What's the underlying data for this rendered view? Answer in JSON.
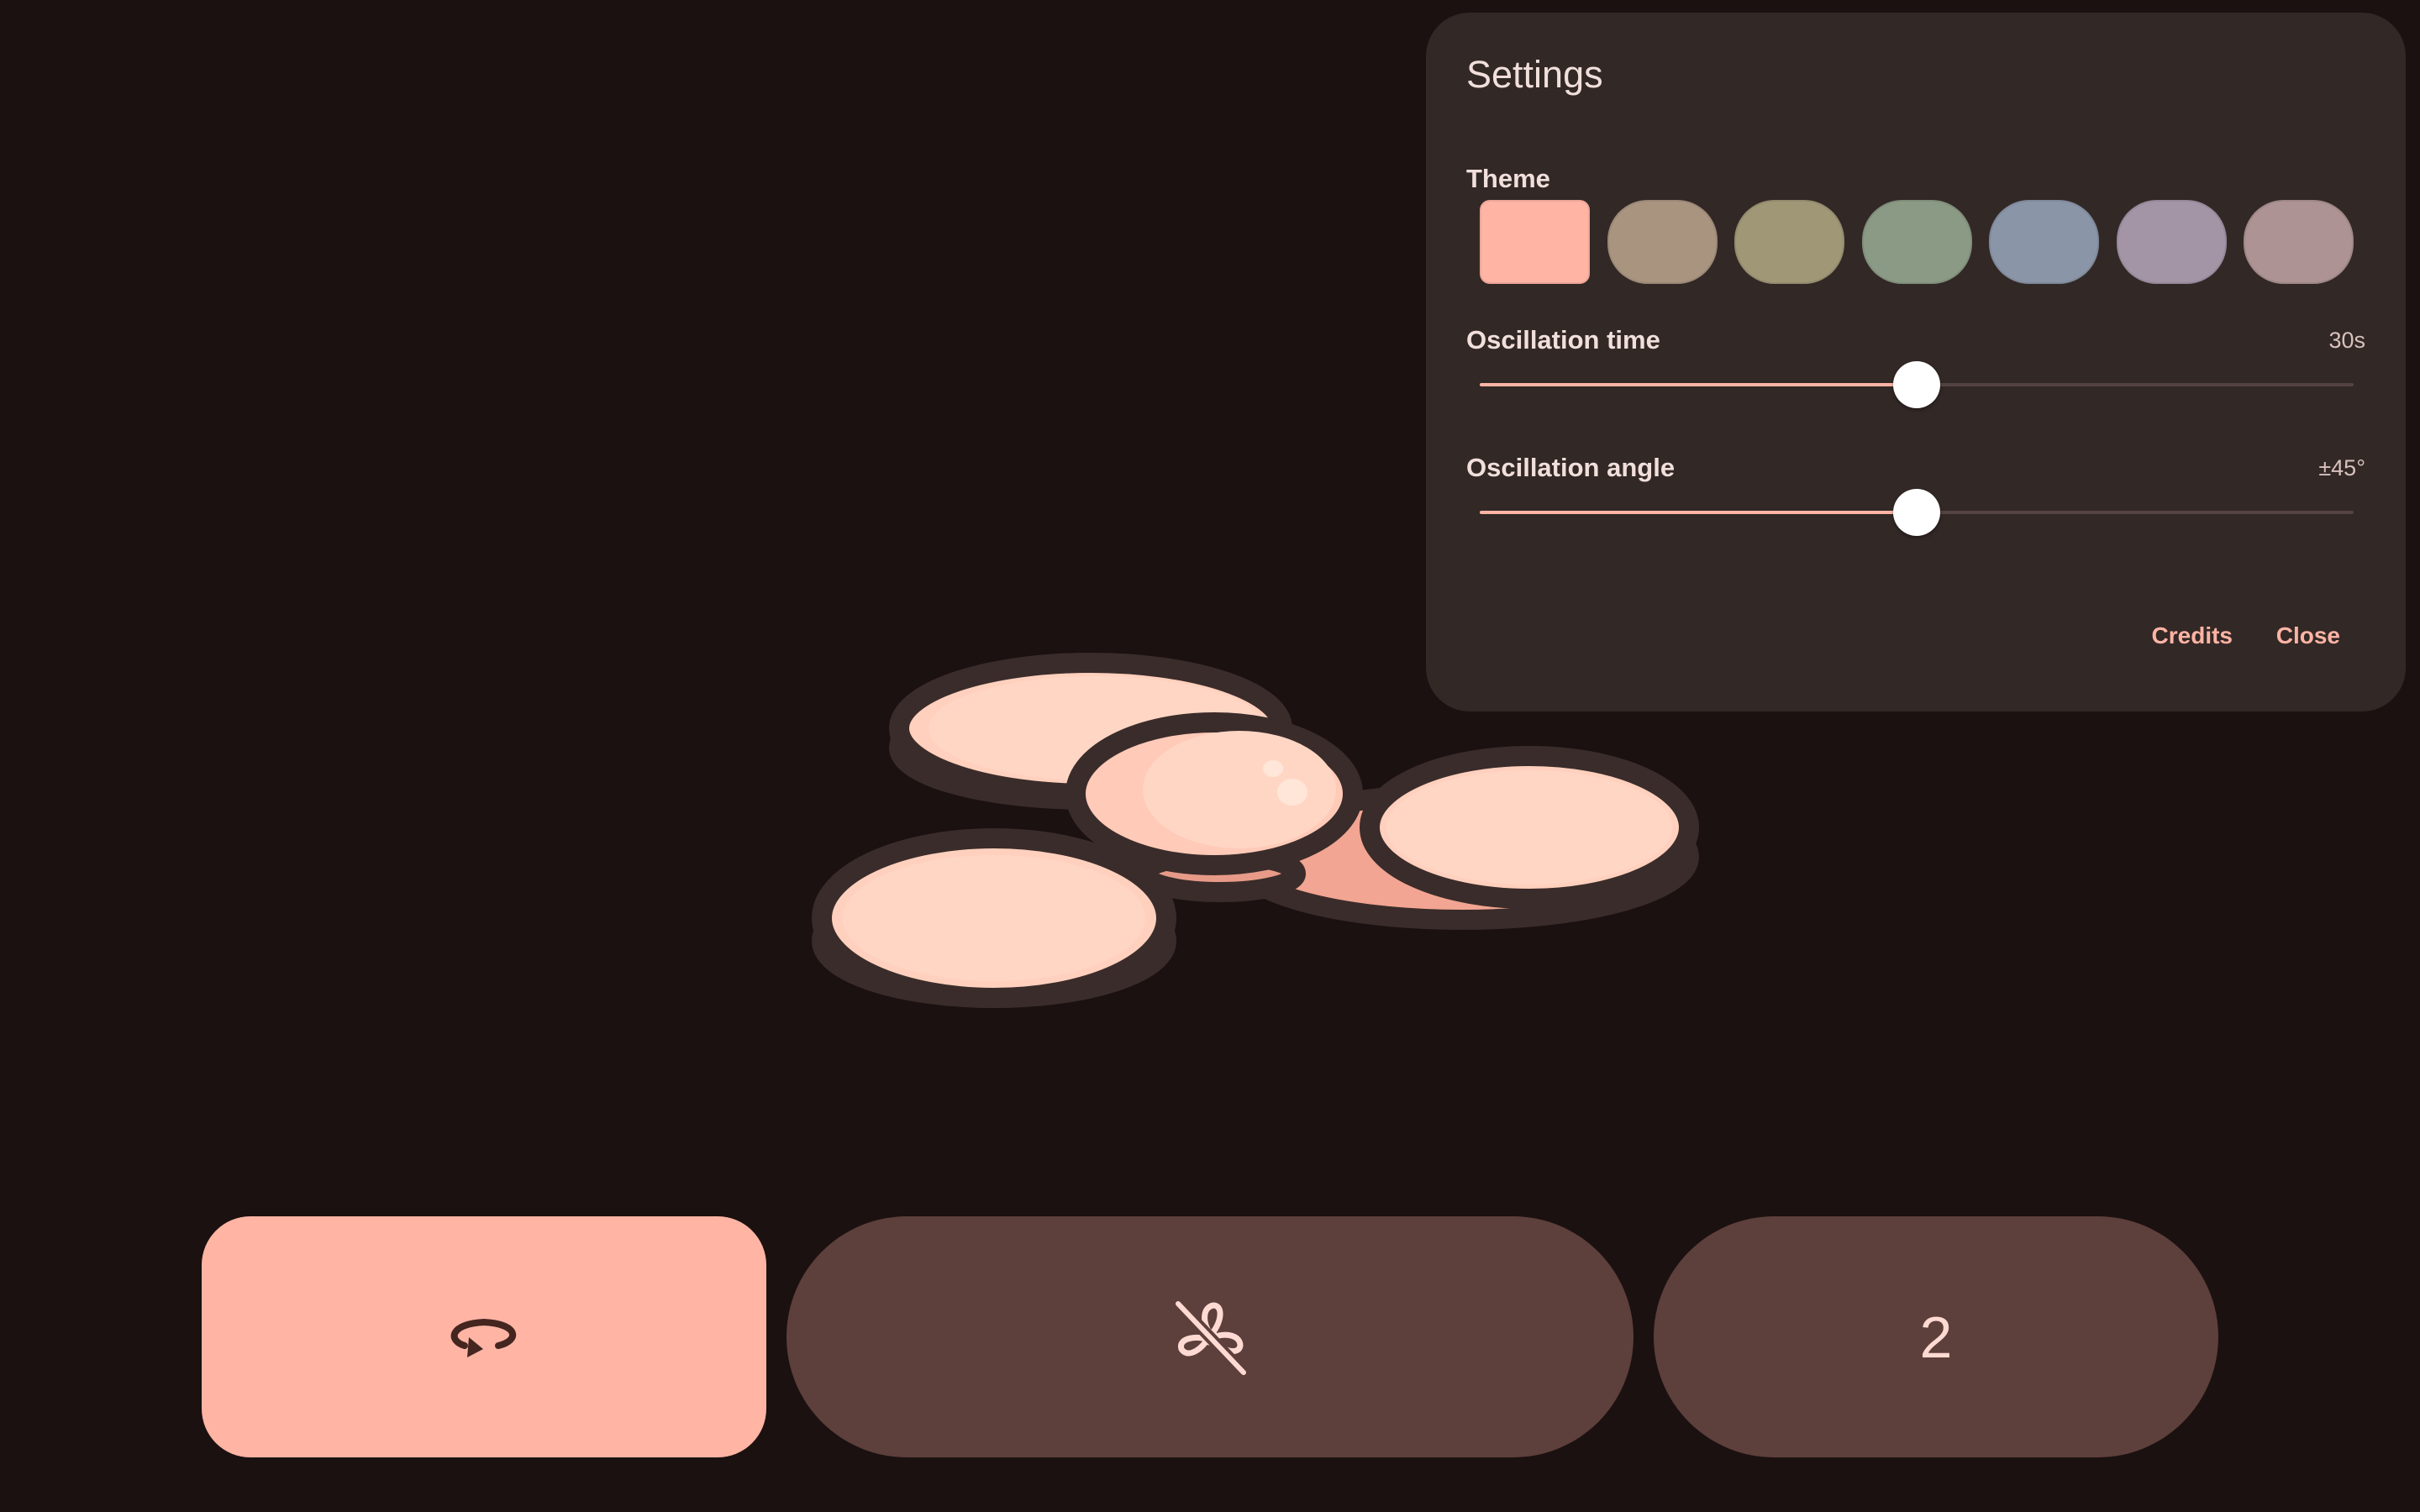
{
  "colors": {
    "background": "#1b1110",
    "panel": "#322826",
    "accent": "#ffb4a4",
    "button_dark": "#5d3f3b"
  },
  "settings": {
    "title": "Settings",
    "theme_label": "Theme",
    "theme_swatches": [
      {
        "color": "#ffb4a4",
        "selected": true
      },
      {
        "color": "#a99480",
        "selected": false
      },
      {
        "color": "#a09777",
        "selected": false
      },
      {
        "color": "#8b9a85",
        "selected": false
      },
      {
        "color": "#8a95a8",
        "selected": false
      },
      {
        "color": "#a394a6",
        "selected": false
      },
      {
        "color": "#ad9393",
        "selected": false
      }
    ],
    "oscillation_time": {
      "label": "Oscillation time",
      "value_text": "30s",
      "level": 0.5
    },
    "oscillation_angle": {
      "label": "Oscillation angle",
      "value_text": "±45°",
      "level": 0.5
    },
    "credits_label": "Credits",
    "close_label": "Close"
  },
  "controls": {
    "rotate_icon": "rotate-icon",
    "oscillate_icon": "fan-off-icon",
    "speed_value": "2"
  }
}
